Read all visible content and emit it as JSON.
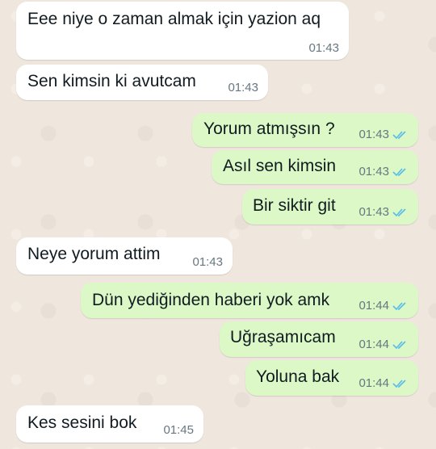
{
  "messages": [
    {
      "text": "Eee niye o zaman almak için yazion aq",
      "time": "01:43",
      "direction": "in"
    },
    {
      "text": "Sen kimsin ki avutcam",
      "time": "01:43",
      "direction": "in"
    },
    {
      "text": "Yorum atmışsın ?",
      "time": "01:43",
      "direction": "out",
      "status": "read"
    },
    {
      "text": "Asıl sen kimsin",
      "time": "01:43",
      "direction": "out",
      "status": "read"
    },
    {
      "text": "Bir siktir git",
      "time": "01:43",
      "direction": "out",
      "status": "read"
    },
    {
      "text": "Neye yorum attim",
      "time": "01:43",
      "direction": "in"
    },
    {
      "text": "Dün yediğinden haberi yok amk",
      "time": "01:44",
      "direction": "out",
      "status": "read"
    },
    {
      "text": "Uğraşamıcam",
      "time": "01:44",
      "direction": "out",
      "status": "read"
    },
    {
      "text": "Yoluna bak",
      "time": "01:44",
      "direction": "out",
      "status": "read"
    },
    {
      "text": "Kes sesini bok",
      "time": "01:45",
      "direction": "in"
    }
  ],
  "colors": {
    "background": "#efe7de",
    "incoming_bubble": "#ffffff",
    "outgoing_bubble": "#dcf8c6",
    "read_ticks": "#53bdeb",
    "timestamp": "#667781"
  }
}
